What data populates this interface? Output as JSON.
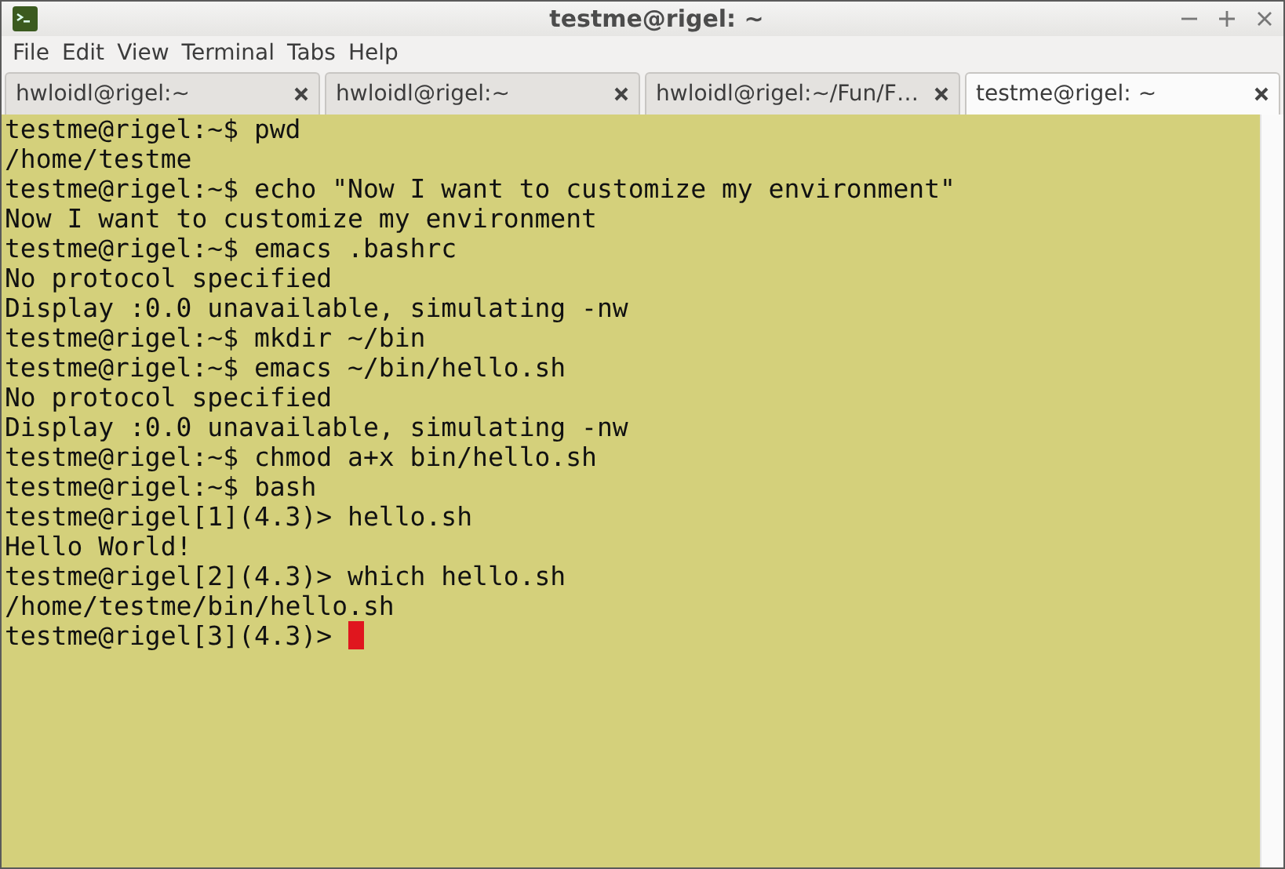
{
  "window": {
    "title": "testme@rigel: ~"
  },
  "menu": [
    "File",
    "Edit",
    "View",
    "Terminal",
    "Tabs",
    "Help"
  ],
  "tabs": [
    {
      "label": "hwloidl@rigel:~",
      "selected": false
    },
    {
      "label": "hwloidl@rigel:~",
      "selected": false
    },
    {
      "label": "hwloidl@rigel:~/Fun/F…",
      "selected": false
    },
    {
      "label": "testme@rigel: ~",
      "selected": true
    }
  ],
  "terminal": {
    "lines": [
      "testme@rigel:~$ pwd",
      "/home/testme",
      "testme@rigel:~$ echo \"Now I want to customize my environment\"",
      "Now I want to customize my environment",
      "testme@rigel:~$ emacs .bashrc",
      "No protocol specified",
      "Display :0.0 unavailable, simulating -nw",
      "testme@rigel:~$ mkdir ~/bin",
      "testme@rigel:~$ emacs ~/bin/hello.sh",
      "No protocol specified",
      "Display :0.0 unavailable, simulating -nw",
      "testme@rigel:~$ chmod a+x bin/hello.sh",
      "testme@rigel:~$ bash",
      "testme@rigel[1](4.3)> hello.sh",
      "Hello World!",
      "testme@rigel[2](4.3)> which hello.sh",
      "/home/testme/bin/hello.sh"
    ],
    "prompt": "testme@rigel[3](4.3)> "
  }
}
